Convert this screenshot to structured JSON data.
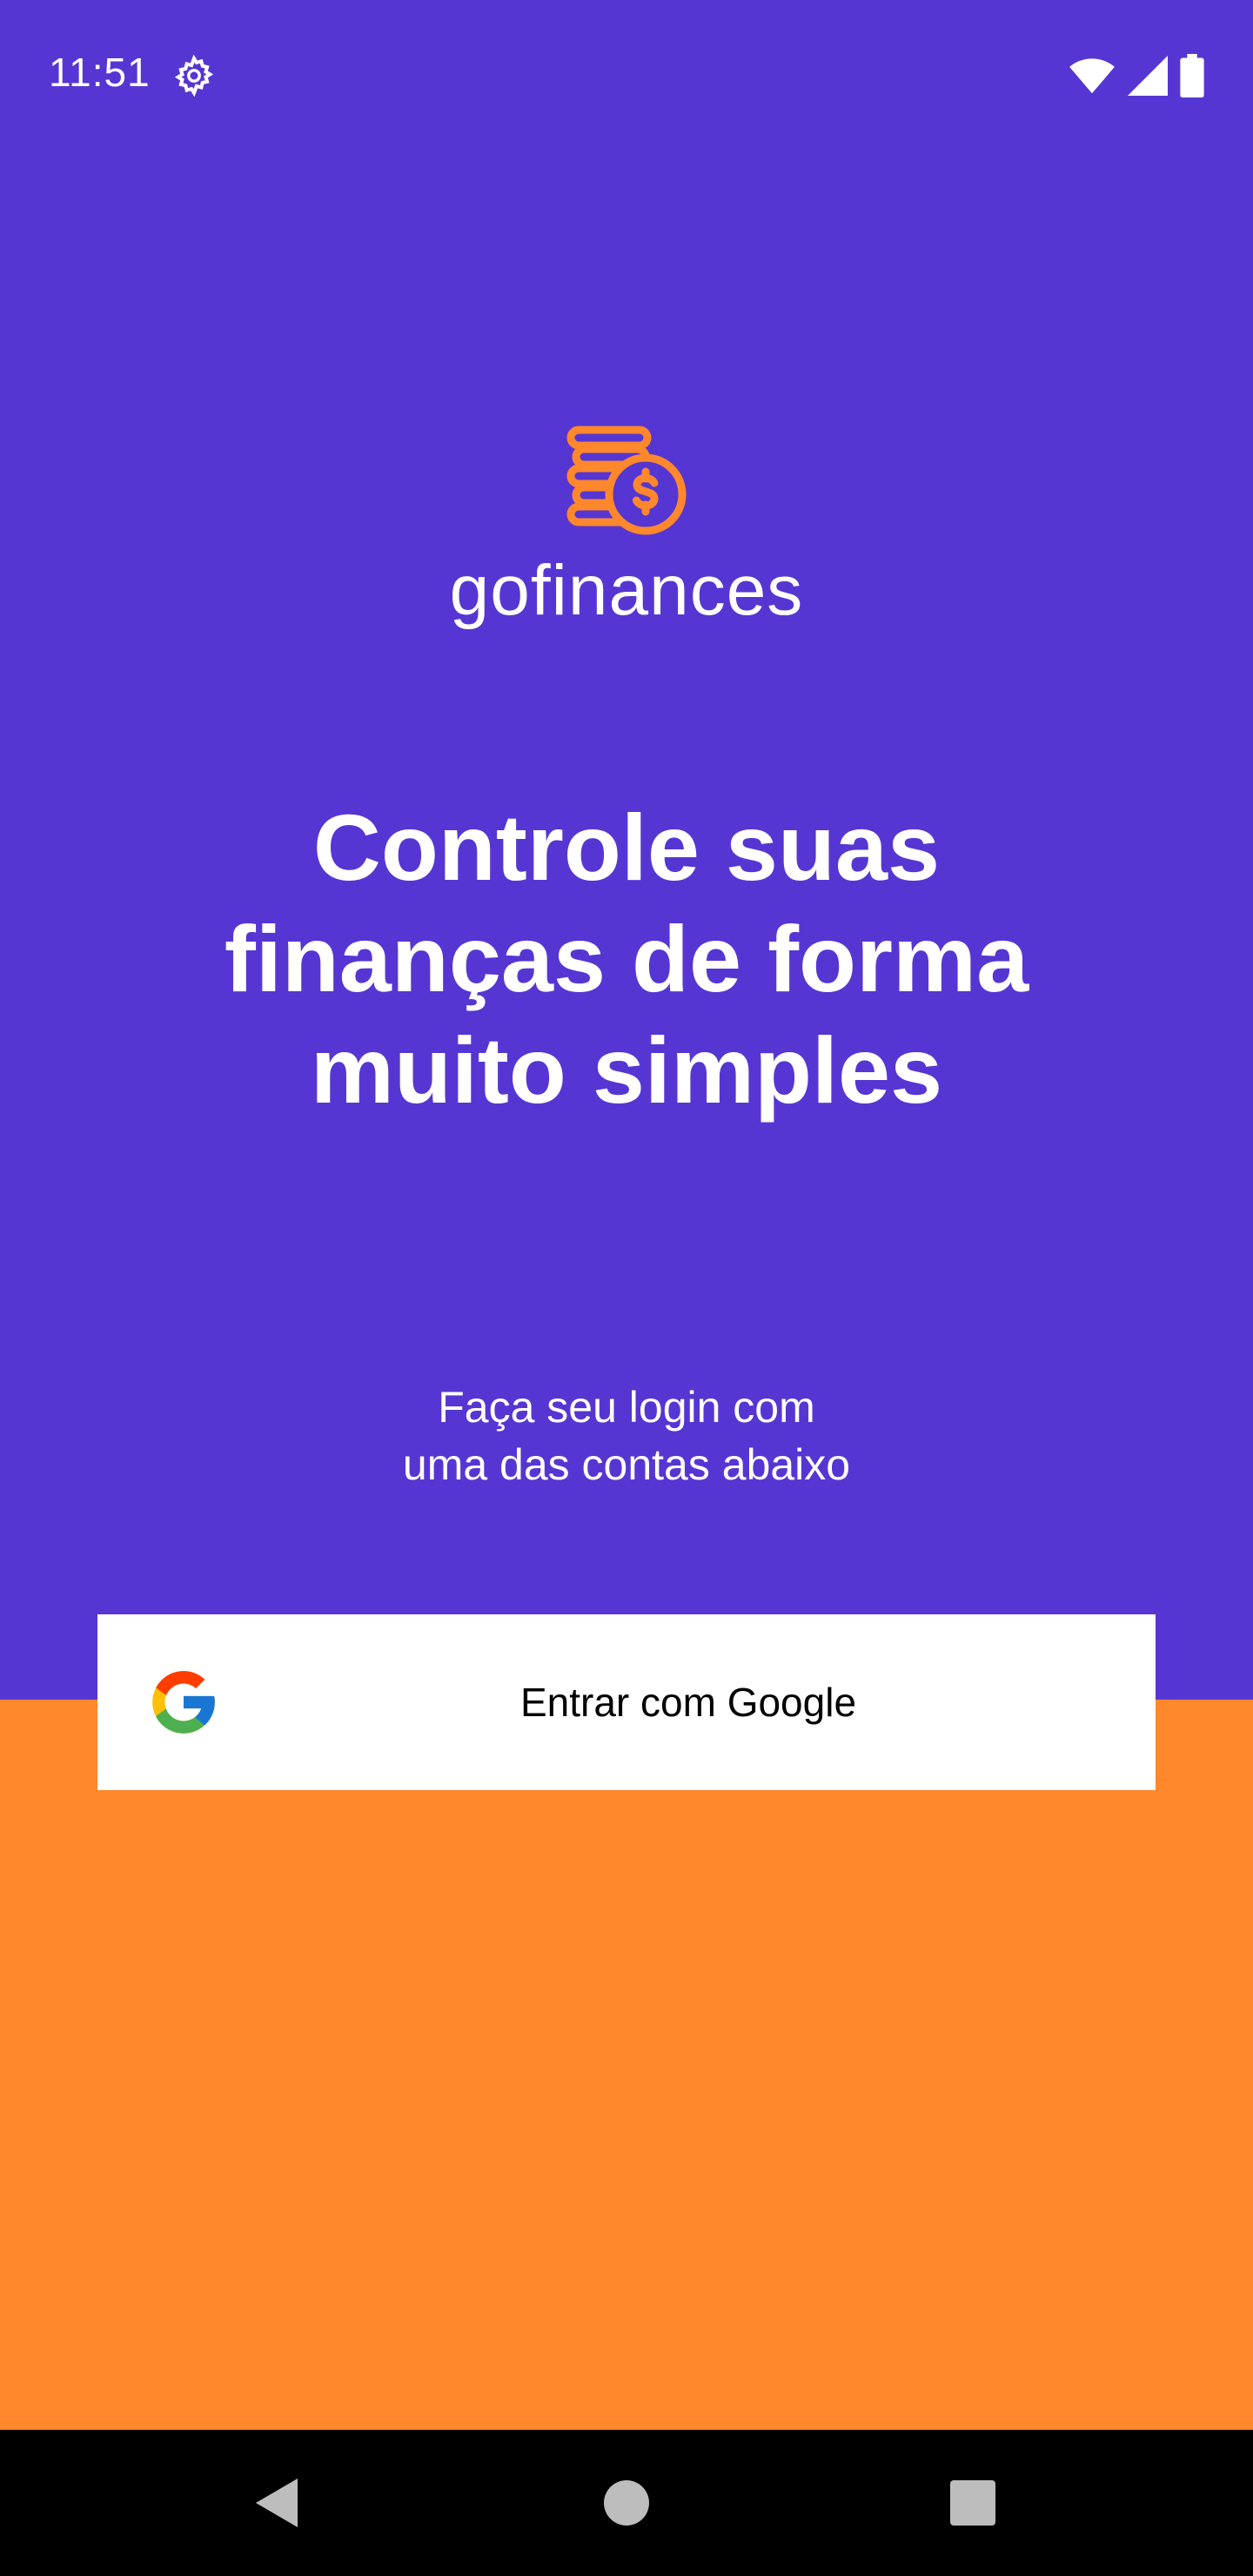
{
  "status_bar": {
    "time": "11:51",
    "icons": [
      "gear-icon",
      "wifi-icon",
      "signal-icon",
      "battery-icon"
    ]
  },
  "logo": {
    "icon": "coins-dollar-icon",
    "text": "gofinances"
  },
  "headline": {
    "line1": "Controle suas",
    "line2": "finanças de forma",
    "line3": "muito simples"
  },
  "login_prompt": {
    "line1": "Faça seu login com",
    "line2": "uma das contas abaixo"
  },
  "google_button": {
    "label": "Entrar com Google",
    "icon": "google-icon"
  },
  "nav": {
    "icons": [
      "back-icon",
      "home-icon",
      "recents-icon"
    ]
  },
  "colors": {
    "primary": "#5636d3",
    "secondary": "#ff872c",
    "shape": "#ffffff",
    "nav_bar": "#000000"
  }
}
